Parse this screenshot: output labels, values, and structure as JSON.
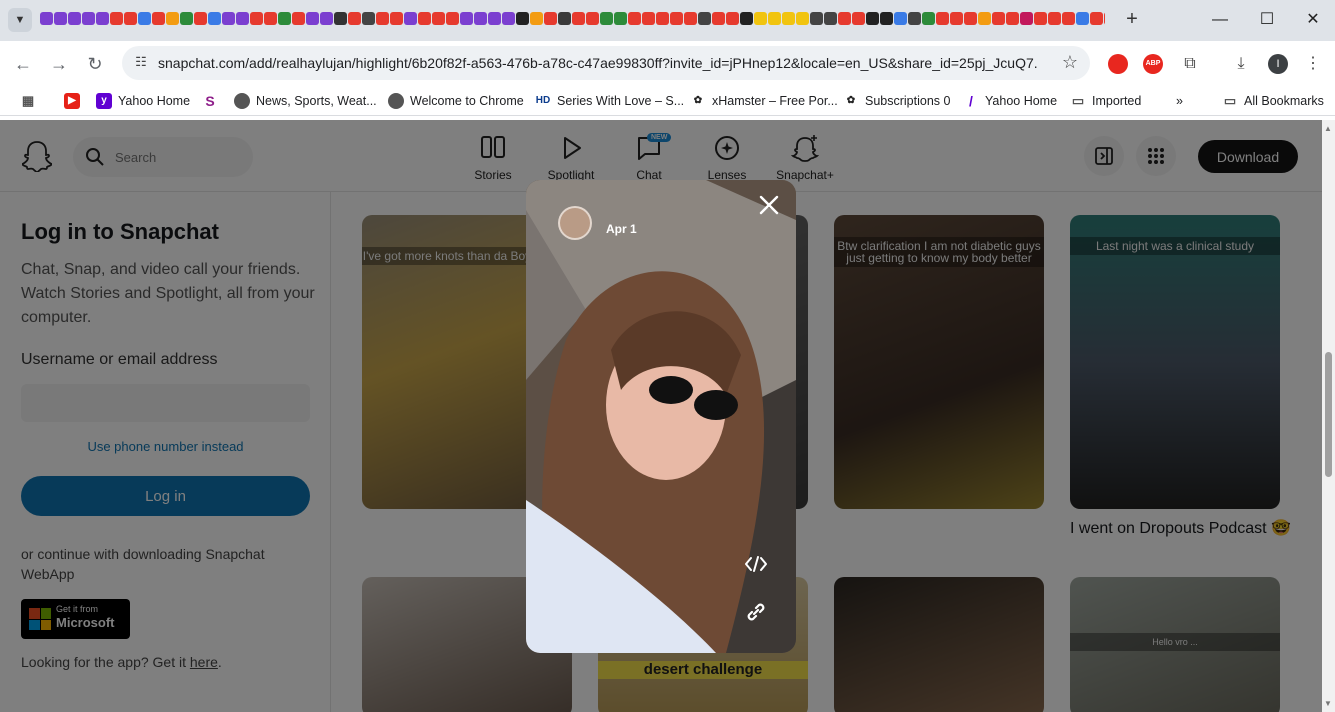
{
  "browser": {
    "url": "snapchat.com/add/realhaylujan/highlight/6b20f82f-a563-476b-a78c-c47ae99830ff?invite_id=jPHnep12&locale=en_US&share_id=25pj_JcuQ7...",
    "bookmarks": [
      {
        "label": ""
      },
      {
        "label": "Yahoo Home"
      },
      {
        "label": ""
      },
      {
        "label": "News, Sports, Weat..."
      },
      {
        "label": "Welcome to Chrome"
      },
      {
        "label": "Series With Love – S..."
      },
      {
        "label": "xHamster – Free Por..."
      },
      {
        "label": "Subscriptions 0"
      },
      {
        "label": "Yahoo Home"
      },
      {
        "label": "Imported"
      }
    ],
    "more_bookmarks": "»",
    "all_bookmarks": "All Bookmarks",
    "extensions": {
      "abp": "ABP",
      "profile": "I"
    },
    "favicon_colors": [
      "#7b3fd0",
      "#7b3fd0",
      "#7b3fd0",
      "#7b3fd0",
      "#7b3fd0",
      "#e63a2e",
      "#e63a2e",
      "#3a7be6",
      "#e63a2e",
      "#f39c12",
      "#2d8b3a",
      "#e63a2e",
      "#3a7be6",
      "#7b3fd0",
      "#7b3fd0",
      "#e63a2e",
      "#e63a2e",
      "#2d8b3a",
      "#e63a2e",
      "#7b3fd0",
      "#7b3fd0",
      "#333333",
      "#e63a2e",
      "#444444",
      "#e63a2e",
      "#e63a2e",
      "#7b3fd0",
      "#e63a2e",
      "#e63a2e",
      "#e63a2e",
      "#7b3fd0",
      "#7b3fd0",
      "#7b3fd0",
      "#7b3fd0",
      "#222222",
      "#f39c12",
      "#e63a2e",
      "#3a3a3a",
      "#e63a2e",
      "#e63a2e",
      "#2d8b3a",
      "#2d8b3a",
      "#e63a2e",
      "#e63a2e",
      "#e63a2e",
      "#e63a2e",
      "#e63a2e",
      "#444444",
      "#e63a2e",
      "#e63a2e",
      "#222222",
      "#f1c40f",
      "#f1c40f",
      "#f1c40f",
      "#f1c40f",
      "#444444",
      "#444444",
      "#e63a2e",
      "#e63a2e",
      "#222222",
      "#222222",
      "#3a7be6",
      "#444444",
      "#2d8b3a",
      "#e63a2e",
      "#e63a2e",
      "#e63a2e",
      "#f39c12",
      "#e63a2e",
      "#e63a2e",
      "#c2185b",
      "#e63a2e",
      "#e63a2e",
      "#e63a2e",
      "#3a7be6",
      "#e63a2e",
      "#e63a2e"
    ]
  },
  "snap": {
    "search_placeholder": "Search",
    "nav": [
      {
        "label": "Stories"
      },
      {
        "label": "Spotlight"
      },
      {
        "label": "Chat"
      },
      {
        "label": "Lenses"
      },
      {
        "label": "Snapchat+"
      }
    ],
    "new_badge": "NEW",
    "download_label": "Download"
  },
  "login": {
    "title": "Log in to Snapchat",
    "description": "Chat, Snap, and video call your friends. Watch Stories and Spotlight, all from your computer.",
    "username_label": "Username or email address",
    "username_value": "",
    "phone_link": "Use phone number instead",
    "login_button": "Log in",
    "continue_text": "or continue with downloading Snapchat WebApp",
    "ms_small": "Get it from",
    "ms_big": "Microsoft",
    "looking_prefix": "Looking for the app? Get it ",
    "looking_link": "here",
    "looking_suffix": "."
  },
  "cards": [
    {
      "caption": "I've got more knots than da Boy Scouts"
    },
    {
      "caption": "Btw clarification I am not diabetic guys just getting to know my body better"
    },
    {
      "caption": "Last night was a clinical study"
    },
    {
      "caption": "desert challenge"
    },
    {
      "caption": "Hello vro ..."
    }
  ],
  "card_title": "I went on Dropouts Podcast 🤓",
  "story": {
    "date": "Apr 1"
  }
}
